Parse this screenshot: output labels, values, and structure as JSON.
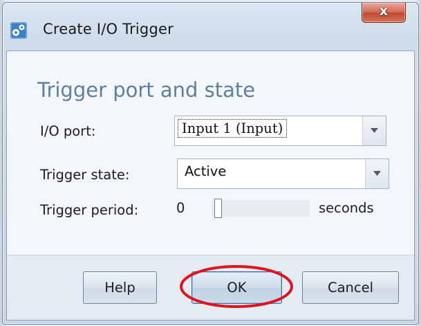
{
  "window": {
    "title": "Create I/O Trigger",
    "icon": "trigger-gear-icon",
    "close_glyph": "x",
    "close_icon": "close-icon"
  },
  "form": {
    "heading": "Trigger port and state",
    "io_port": {
      "label": "I/O port:",
      "value": "Input 1 (Input)"
    },
    "trigger_state": {
      "label": "Trigger state:",
      "value": "Active"
    },
    "trigger_period": {
      "label": "Trigger period:",
      "value": "0",
      "unit": "seconds",
      "slider_fraction": 0.0
    }
  },
  "buttons": {
    "help": "Help",
    "ok": "OK",
    "cancel": "Cancel"
  },
  "annotation": {
    "highlight_color": "#e0141e",
    "highlighted": "OK"
  },
  "colors": {
    "heading": "#5f7f9c",
    "close_button": "#c24a33",
    "dialog_background": "#f3f6fa"
  }
}
